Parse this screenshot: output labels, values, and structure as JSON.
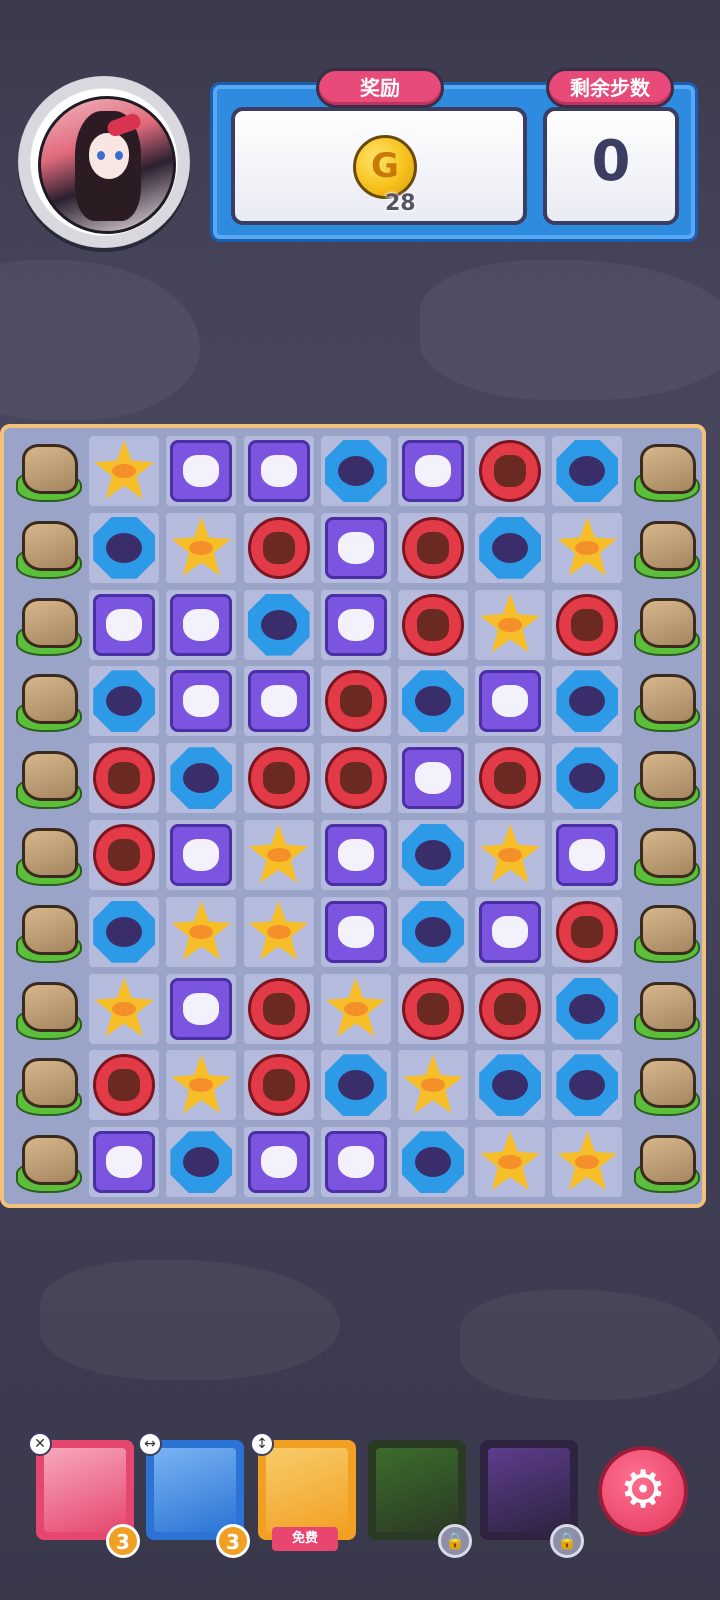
{
  "reward": {
    "label": "奖励",
    "coin_letter": "G",
    "coin_amount": "28"
  },
  "steps": {
    "label": "剩余步数",
    "value": "0"
  },
  "board": {
    "columns": 9,
    "rows": [
      [
        "rock",
        "star",
        "square",
        "square",
        "oct",
        "square",
        "circle",
        "oct",
        "rock"
      ],
      [
        "rock",
        "oct",
        "star",
        "circle",
        "square",
        "circle",
        "oct",
        "star",
        "rock"
      ],
      [
        "rock",
        "square",
        "square",
        "oct",
        "square",
        "circle",
        "star",
        "circle",
        "rock"
      ],
      [
        "rock",
        "oct",
        "square",
        "square",
        "circle",
        "oct",
        "square",
        "oct",
        "rock"
      ],
      [
        "rock",
        "circle",
        "oct",
        "circle",
        "circle",
        "square",
        "circle",
        "oct",
        "rock"
      ],
      [
        "rock",
        "circle",
        "square",
        "star",
        "square",
        "oct",
        "star",
        "square",
        "rock"
      ],
      [
        "rock",
        "oct",
        "star",
        "star",
        "square",
        "oct",
        "square",
        "circle",
        "rock"
      ],
      [
        "rock",
        "star",
        "square",
        "circle",
        "star",
        "circle",
        "circle",
        "oct",
        "rock"
      ],
      [
        "rock",
        "circle",
        "star",
        "circle",
        "oct",
        "star",
        "oct",
        "oct",
        "rock"
      ],
      [
        "rock",
        "square",
        "oct",
        "square",
        "square",
        "oct",
        "star",
        "star",
        "rock"
      ]
    ]
  },
  "skills": [
    {
      "name": "skill-1",
      "count": "3",
      "mini_icon": "✕",
      "border": "#e5476e",
      "fill": "#f7a7bd"
    },
    {
      "name": "skill-2",
      "count": "3",
      "mini_icon": "↔",
      "border": "#2b74d6",
      "fill": "#79b3f2"
    },
    {
      "name": "skill-3",
      "free_label": "免费",
      "mini_icon": "↕",
      "border": "#f2a024",
      "fill": "#f8cc6a"
    },
    {
      "name": "skill-4",
      "locked": true,
      "border": "#2b3a25",
      "fill": "#3c6d2c"
    },
    {
      "name": "skill-5",
      "locked": true,
      "border": "#2e2340",
      "fill": "#5d3d8d"
    }
  ],
  "lock_icon": "🔒",
  "settings_icon": "⚙"
}
